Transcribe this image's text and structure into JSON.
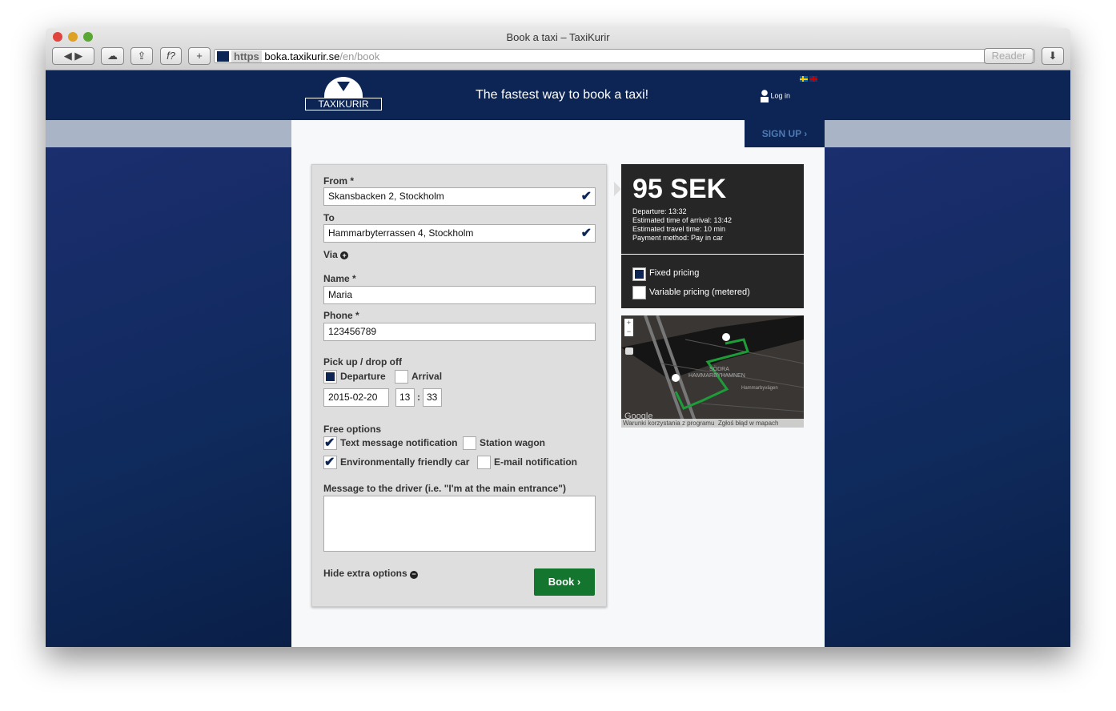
{
  "browser": {
    "title": "Book a taxi – TaxiKurir",
    "url_scheme": "https",
    "url_host": "boka.taxikurir.se",
    "url_path": "/en/book",
    "reader": "Reader"
  },
  "header": {
    "logo": "TAXIKURIR",
    "tagline": "The fastest way to book a taxi!",
    "login": "Log in",
    "signup": "SIGN UP ›"
  },
  "form": {
    "from_label": "From *",
    "from_value": "Skansbacken 2, Stockholm",
    "to_label": "To",
    "to_value": "Hammarbyterrassen 4, Stockholm",
    "via_label": "Via",
    "name_label": "Name *",
    "name_value": "Maria",
    "phone_label": "Phone *",
    "phone_value": "123456789",
    "pickup_label": "Pick up / drop off",
    "departure": "Departure",
    "arrival": "Arrival",
    "date": "2015-02-20",
    "hour": "13",
    "minute": "33",
    "free_options_label": "Free options",
    "options": [
      {
        "label": "Text message notification",
        "checked": true
      },
      {
        "label": "Station wagon",
        "checked": false
      },
      {
        "label": "Environmentally friendly car",
        "checked": true
      },
      {
        "label": "E-mail notification",
        "checked": false
      }
    ],
    "message_label": "Message to the driver (i.e. \"I'm at the main entrance\")",
    "message_value": "",
    "hide_extra": "Hide extra options",
    "book": "Book ›"
  },
  "summary": {
    "price": "95 SEK",
    "departure": "Departure: 13:32",
    "arrival": "Estimated time of arrival: 13:42",
    "travel": "Estimated travel time: 10 min",
    "payment": "Payment method: Pay in car",
    "fixed": "Fixed pricing",
    "variable": "Variable pricing (metered)"
  },
  "map": {
    "district1": "SÖDRA",
    "district2": "HAMMARBYHAMNEN",
    "road": "Hammarbyvägen",
    "google": "Google",
    "terms": "Warunki korzystania z programu",
    "report": "Zgłoś błąd w mapach"
  }
}
